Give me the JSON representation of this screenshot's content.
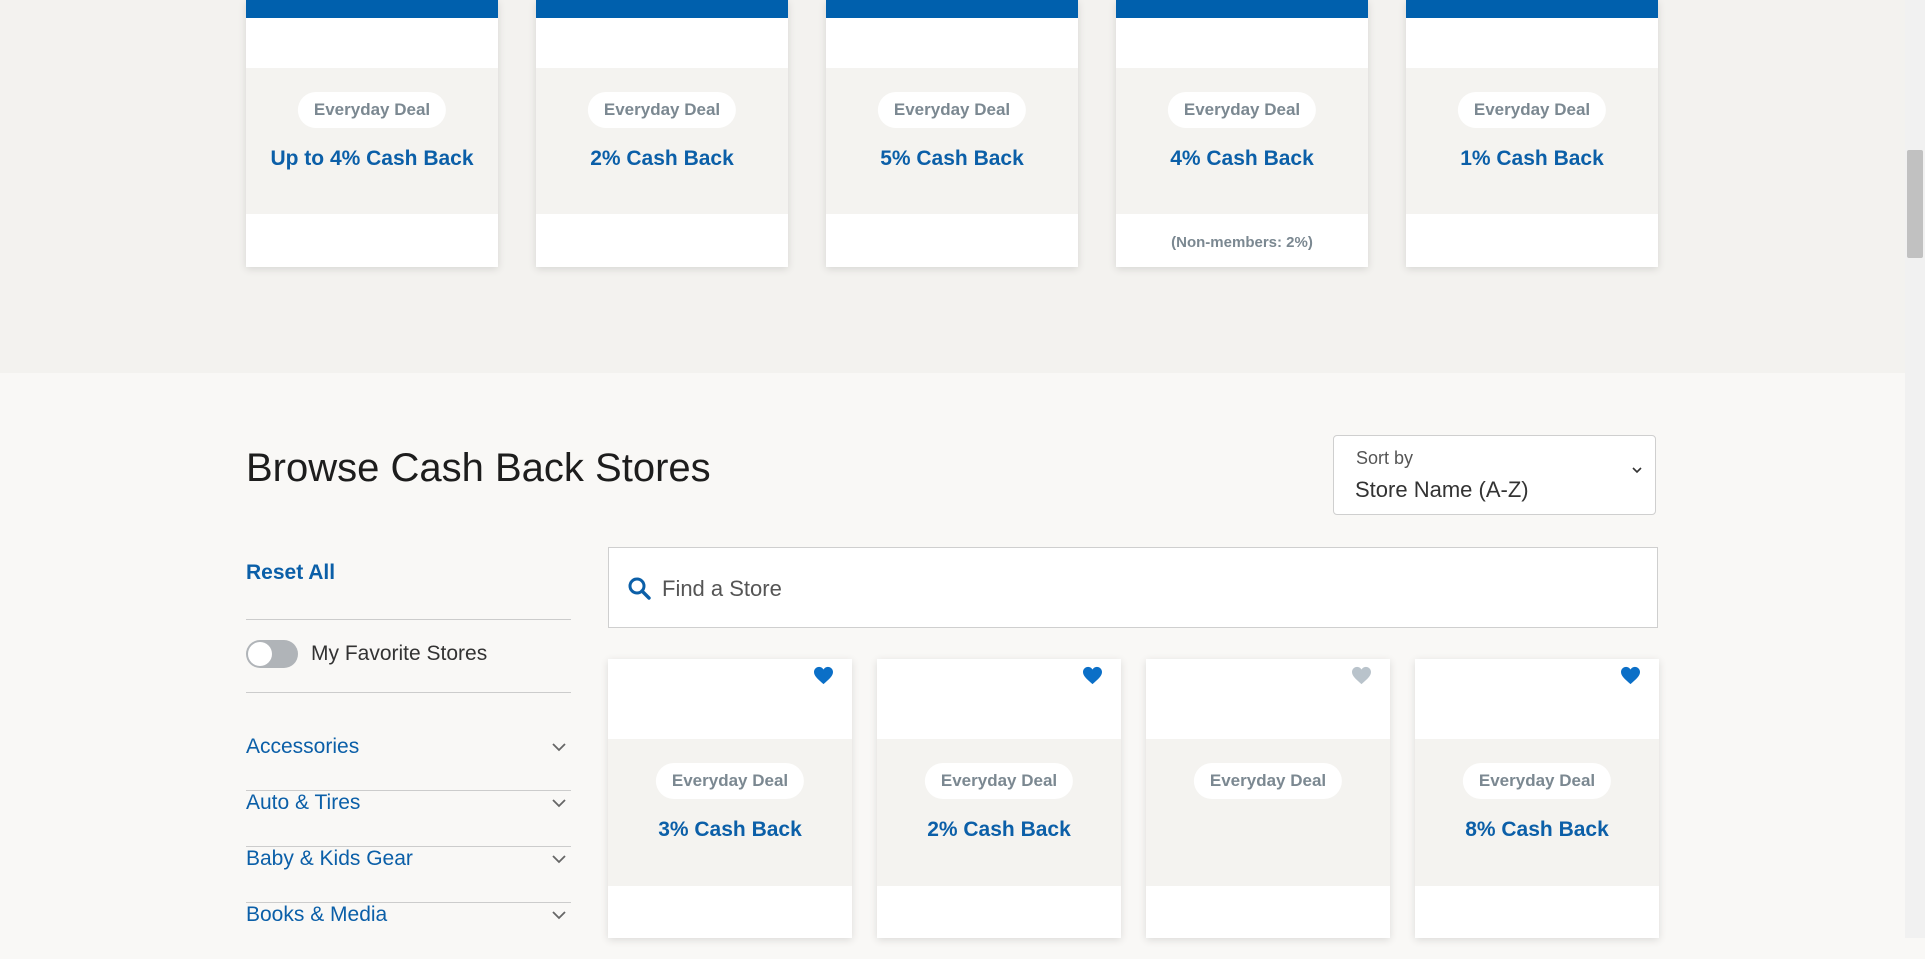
{
  "featured_cards": [
    {
      "deal_label": "Everyday Deal",
      "cash_back": "Up to 4% Cash Back",
      "note": ""
    },
    {
      "deal_label": "Everyday Deal",
      "cash_back": "2% Cash Back",
      "note": ""
    },
    {
      "deal_label": "Everyday Deal",
      "cash_back": "5% Cash Back",
      "note": ""
    },
    {
      "deal_label": "Everyday Deal",
      "cash_back": "4% Cash Back",
      "note": "(Non-members: 2%)"
    },
    {
      "deal_label": "Everyday Deal",
      "cash_back": "1% Cash Back",
      "note": ""
    }
  ],
  "browse": {
    "title": "Browse Cash Back Stores",
    "sort_label": "Sort by",
    "sort_value": "Store Name (A-Z)"
  },
  "filters": {
    "reset_label": "Reset All",
    "favorites_label": "My Favorite Stores",
    "favorites_on": false,
    "categories": [
      "Accessories",
      "Auto & Tires",
      "Baby & Kids Gear",
      "Books & Media"
    ]
  },
  "search": {
    "placeholder": "Find a Store",
    "icon": "search-icon"
  },
  "store_cards": [
    {
      "deal_label": "Everyday Deal",
      "cash_back": "3% Cash Back",
      "favorited": true
    },
    {
      "deal_label": "Everyday Deal",
      "cash_back": "2% Cash Back",
      "favorited": true
    },
    {
      "deal_label": "Everyday Deal",
      "cash_back": "",
      "favorited": false
    },
    {
      "deal_label": "Everyday Deal",
      "cash_back": "8% Cash Back",
      "favorited": true
    }
  ],
  "colors": {
    "brand_blue": "#0060ad",
    "link_blue": "#0b5fa8",
    "heart_active": "#0b6fc7",
    "heart_inactive": "#b9c3cb",
    "pill_text": "#7b8891"
  }
}
